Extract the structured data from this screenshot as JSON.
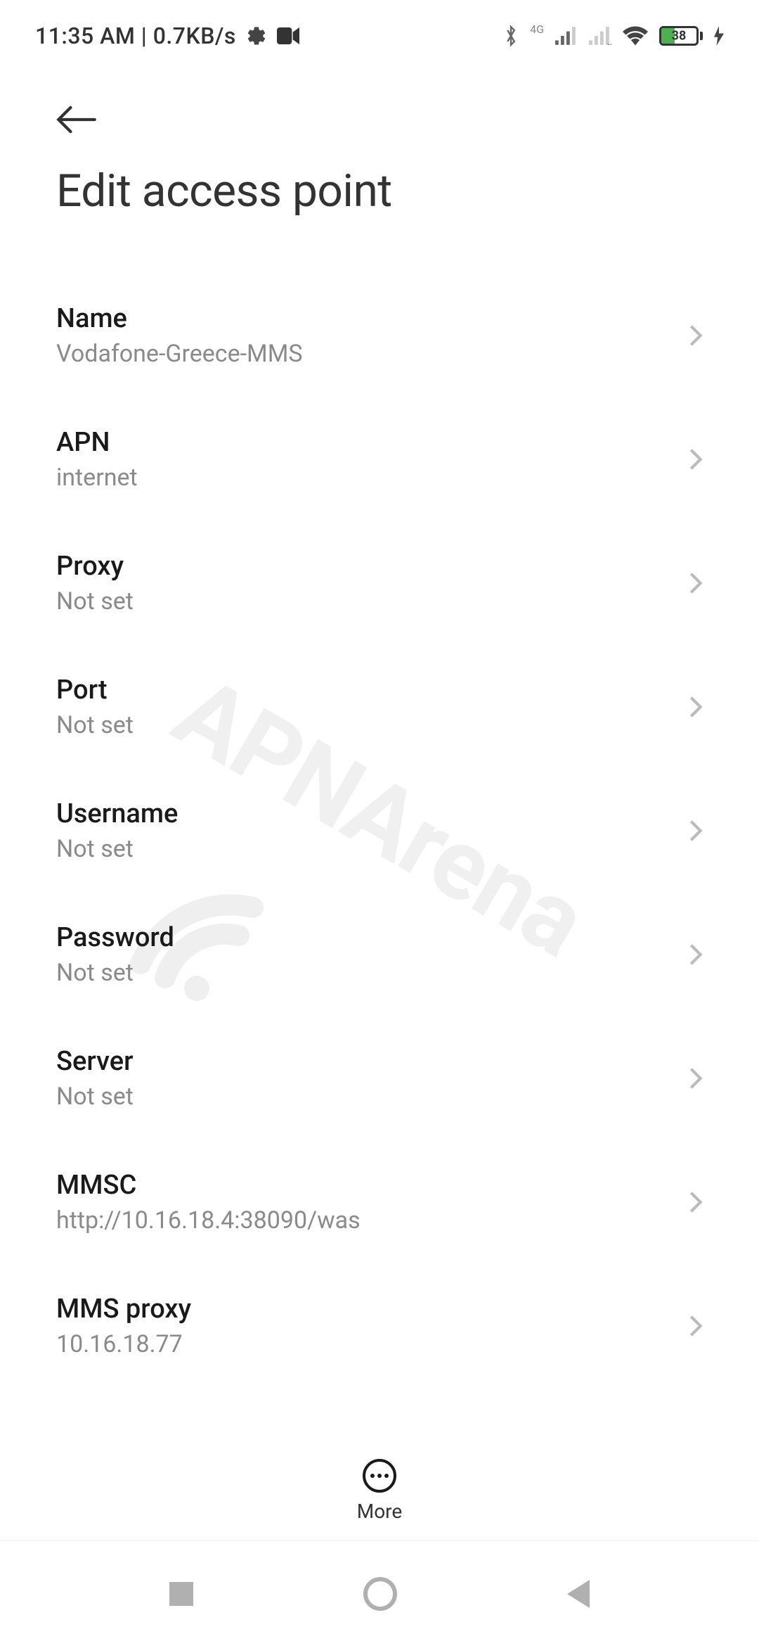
{
  "status": {
    "time": "11:35 AM",
    "data_rate": "0.7KB/s",
    "battery_percent": "38",
    "network_type": "4G"
  },
  "header": {
    "title": "Edit access point"
  },
  "settings": [
    {
      "label": "Name",
      "value": "Vodafone-Greece-MMS"
    },
    {
      "label": "APN",
      "value": "internet"
    },
    {
      "label": "Proxy",
      "value": "Not set"
    },
    {
      "label": "Port",
      "value": "Not set"
    },
    {
      "label": "Username",
      "value": "Not set"
    },
    {
      "label": "Password",
      "value": "Not set"
    },
    {
      "label": "Server",
      "value": "Not set"
    },
    {
      "label": "MMSC",
      "value": "http://10.16.18.4:38090/was"
    },
    {
      "label": "MMS proxy",
      "value": "10.16.18.77"
    }
  ],
  "bottom": {
    "more_label": "More"
  },
  "watermark": "APNArena"
}
